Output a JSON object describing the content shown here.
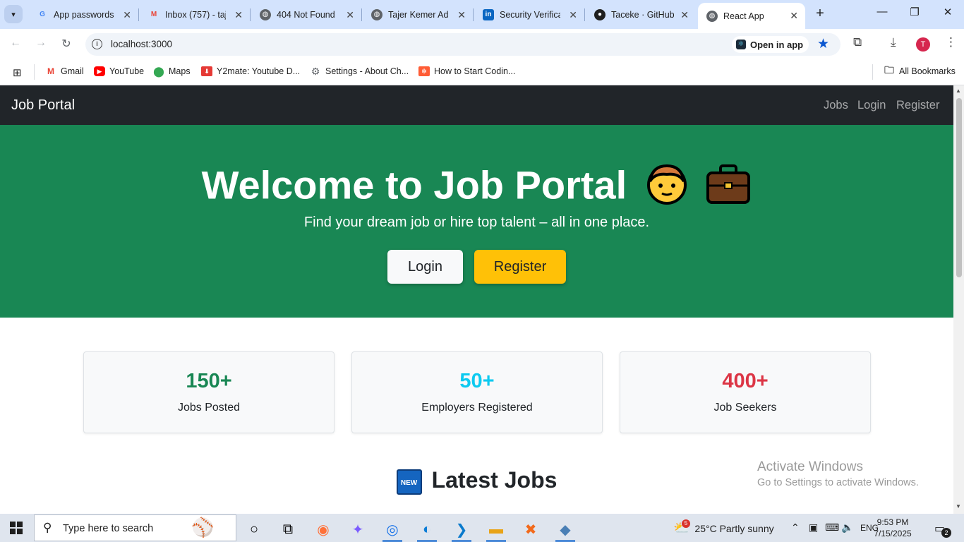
{
  "browser": {
    "tabs": [
      {
        "title": "App passwords",
        "favicon": "google-icon",
        "color": "#4285f4"
      },
      {
        "title": "Inbox (757) - taj",
        "favicon": "gmail-icon",
        "color": "#ea4335"
      },
      {
        "title": "404 Not Found",
        "favicon": "globe-icon",
        "color": "#5f6368"
      },
      {
        "title": "Tajer Kemer Ada",
        "favicon": "globe-icon",
        "color": "#5f6368"
      },
      {
        "title": "Security Verificat",
        "favicon": "linkedin-icon",
        "color": "#0a66c2"
      },
      {
        "title": "Taceke · GitHub",
        "favicon": "github-icon",
        "color": "#1f1f1f"
      },
      {
        "title": "React App",
        "favicon": "globe-icon",
        "color": "#5f6368"
      }
    ],
    "url": "localhost:3000",
    "open_in_app": "Open in app",
    "profile_initial": "T",
    "bookmarks": [
      {
        "label": "Gmail",
        "icon": "gmail-icon",
        "color": "#ea4335"
      },
      {
        "label": "YouTube",
        "icon": "youtube-icon",
        "color": "#ff0000"
      },
      {
        "label": "Maps",
        "icon": "maps-icon",
        "color": "#34a853"
      },
      {
        "label": "Y2mate: Youtube D...",
        "icon": "download-icon",
        "color": "#e53935"
      },
      {
        "label": "Settings - About Ch...",
        "icon": "gear-icon",
        "color": "#5f6368"
      },
      {
        "label": "How to Start Codin...",
        "icon": "hubspot-icon",
        "color": "#ff5c35"
      }
    ],
    "all_bookmarks": "All Bookmarks"
  },
  "page": {
    "brand": "Job Portal",
    "nav": [
      "Jobs",
      "Login",
      "Register"
    ],
    "hero": {
      "title": "Welcome to Job Portal",
      "subtitle": "Find your dream job or hire top talent – all in one place.",
      "login": "Login",
      "register": "Register"
    },
    "stats": [
      {
        "value": "150+",
        "label": "Jobs Posted",
        "color": "#198754"
      },
      {
        "value": "50+",
        "label": "Employers Registered",
        "color": "#0dcaf0"
      },
      {
        "value": "400+",
        "label": "Job Seekers",
        "color": "#dc3545"
      }
    ],
    "latest_jobs": "Latest Jobs",
    "new_badge": "NEW"
  },
  "watermark": {
    "line1": "Activate Windows",
    "line2": "Go to Settings to activate Windows."
  },
  "taskbar": {
    "search_placeholder": "Type here to search",
    "weather": "25°C  Partly sunny",
    "weather_badge": "5",
    "language": "ENG",
    "time": "9:53 PM",
    "date": "7/15/2025",
    "notifications": "2"
  }
}
